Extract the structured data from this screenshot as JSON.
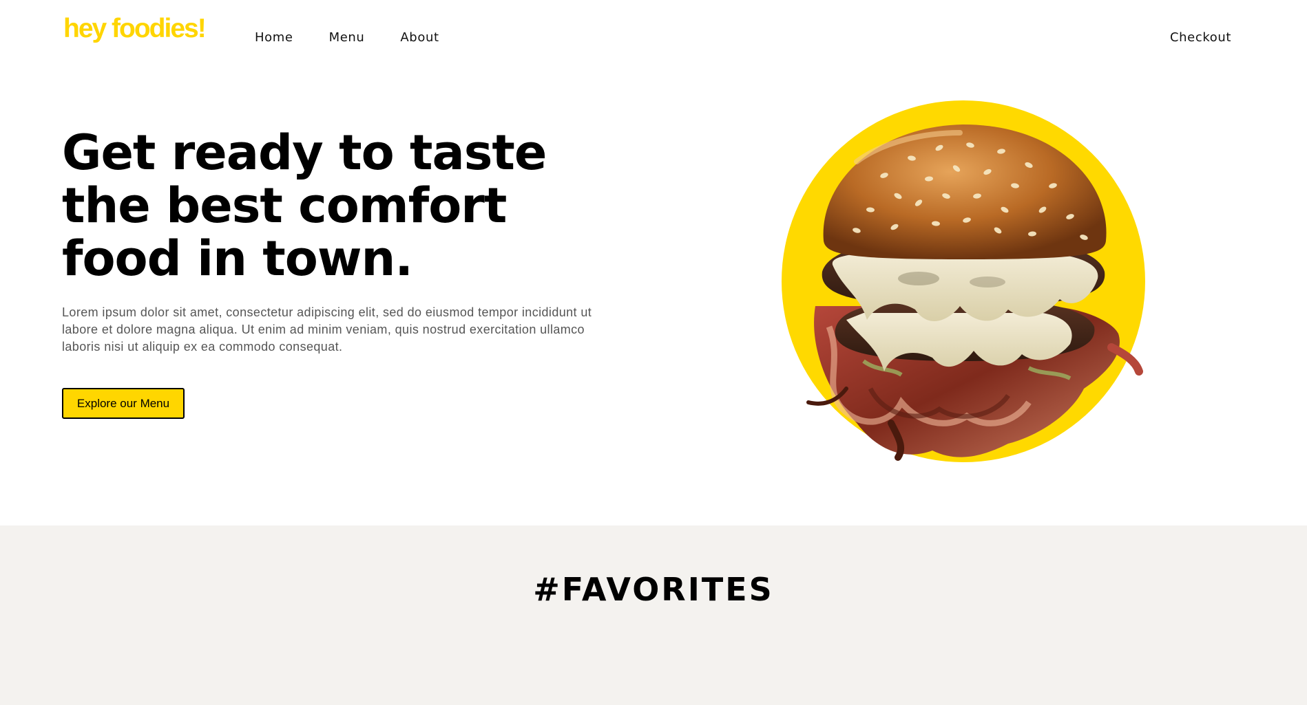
{
  "brand": {
    "logo_text": "hey foodies!",
    "accent_color": "#ffd500"
  },
  "nav": {
    "items": [
      {
        "label": "Home"
      },
      {
        "label": "Menu"
      },
      {
        "label": "About"
      }
    ],
    "checkout_label": "Checkout"
  },
  "hero": {
    "title": "Get ready to taste the best comfort food in town.",
    "description": "Lorem ipsum dolor sit amet, consectetur adipiscing elit, sed do eiusmod tempor incididunt ut labore et dolore magna aliqua. Ut enim ad minim veniam, quis nostrud exercitation ullamco laboris nisi ut aliquip ex ea commodo consequat.",
    "cta_label": "Explore our Menu",
    "image_icon": "burger-image"
  },
  "favorites": {
    "title": "#FAVORITES"
  }
}
